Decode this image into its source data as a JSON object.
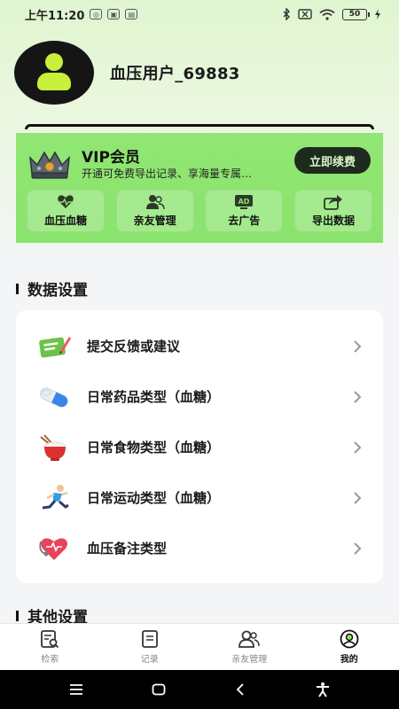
{
  "status_bar": {
    "time": "上午11:20",
    "battery": "50"
  },
  "profile": {
    "username": "血压用户_69883"
  },
  "vip": {
    "title": "VIP会员",
    "subtitle": "开通可免费导出记录、享海量专属…",
    "renew_label": "立即续费",
    "features": [
      {
        "label": "血压血糖",
        "icon": "heart-wave-icon"
      },
      {
        "label": "亲友管理",
        "icon": "users-icon"
      },
      {
        "label": "去广告",
        "icon": "ad-icon"
      },
      {
        "label": "导出数据",
        "icon": "export-icon"
      }
    ]
  },
  "data_settings": {
    "title": "数据设置",
    "items": [
      {
        "label": "提交反馈或建议",
        "icon": "feedback-icon"
      },
      {
        "label": "日常药品类型（血糖）",
        "icon": "pill-icon"
      },
      {
        "label": "日常食物类型（血糖）",
        "icon": "food-bowl-icon"
      },
      {
        "label": "日常运动类型（血糖）",
        "icon": "runner-icon"
      },
      {
        "label": "血压备注类型",
        "icon": "stethoscope-heart-icon"
      }
    ]
  },
  "other_settings": {
    "title": "其他设置"
  },
  "tab_bar": {
    "tabs": [
      {
        "label": "检索",
        "icon": "search-doc-icon"
      },
      {
        "label": "记录",
        "icon": "record-icon"
      },
      {
        "label": "亲友管理",
        "icon": "family-icon"
      },
      {
        "label": "我的",
        "icon": "profile-icon"
      }
    ],
    "active_index": 3
  },
  "colors": {
    "vip_green": "#8ae36d",
    "accent_dark": "#1f2a1f",
    "avatar_lime": "#c8ef3a"
  }
}
